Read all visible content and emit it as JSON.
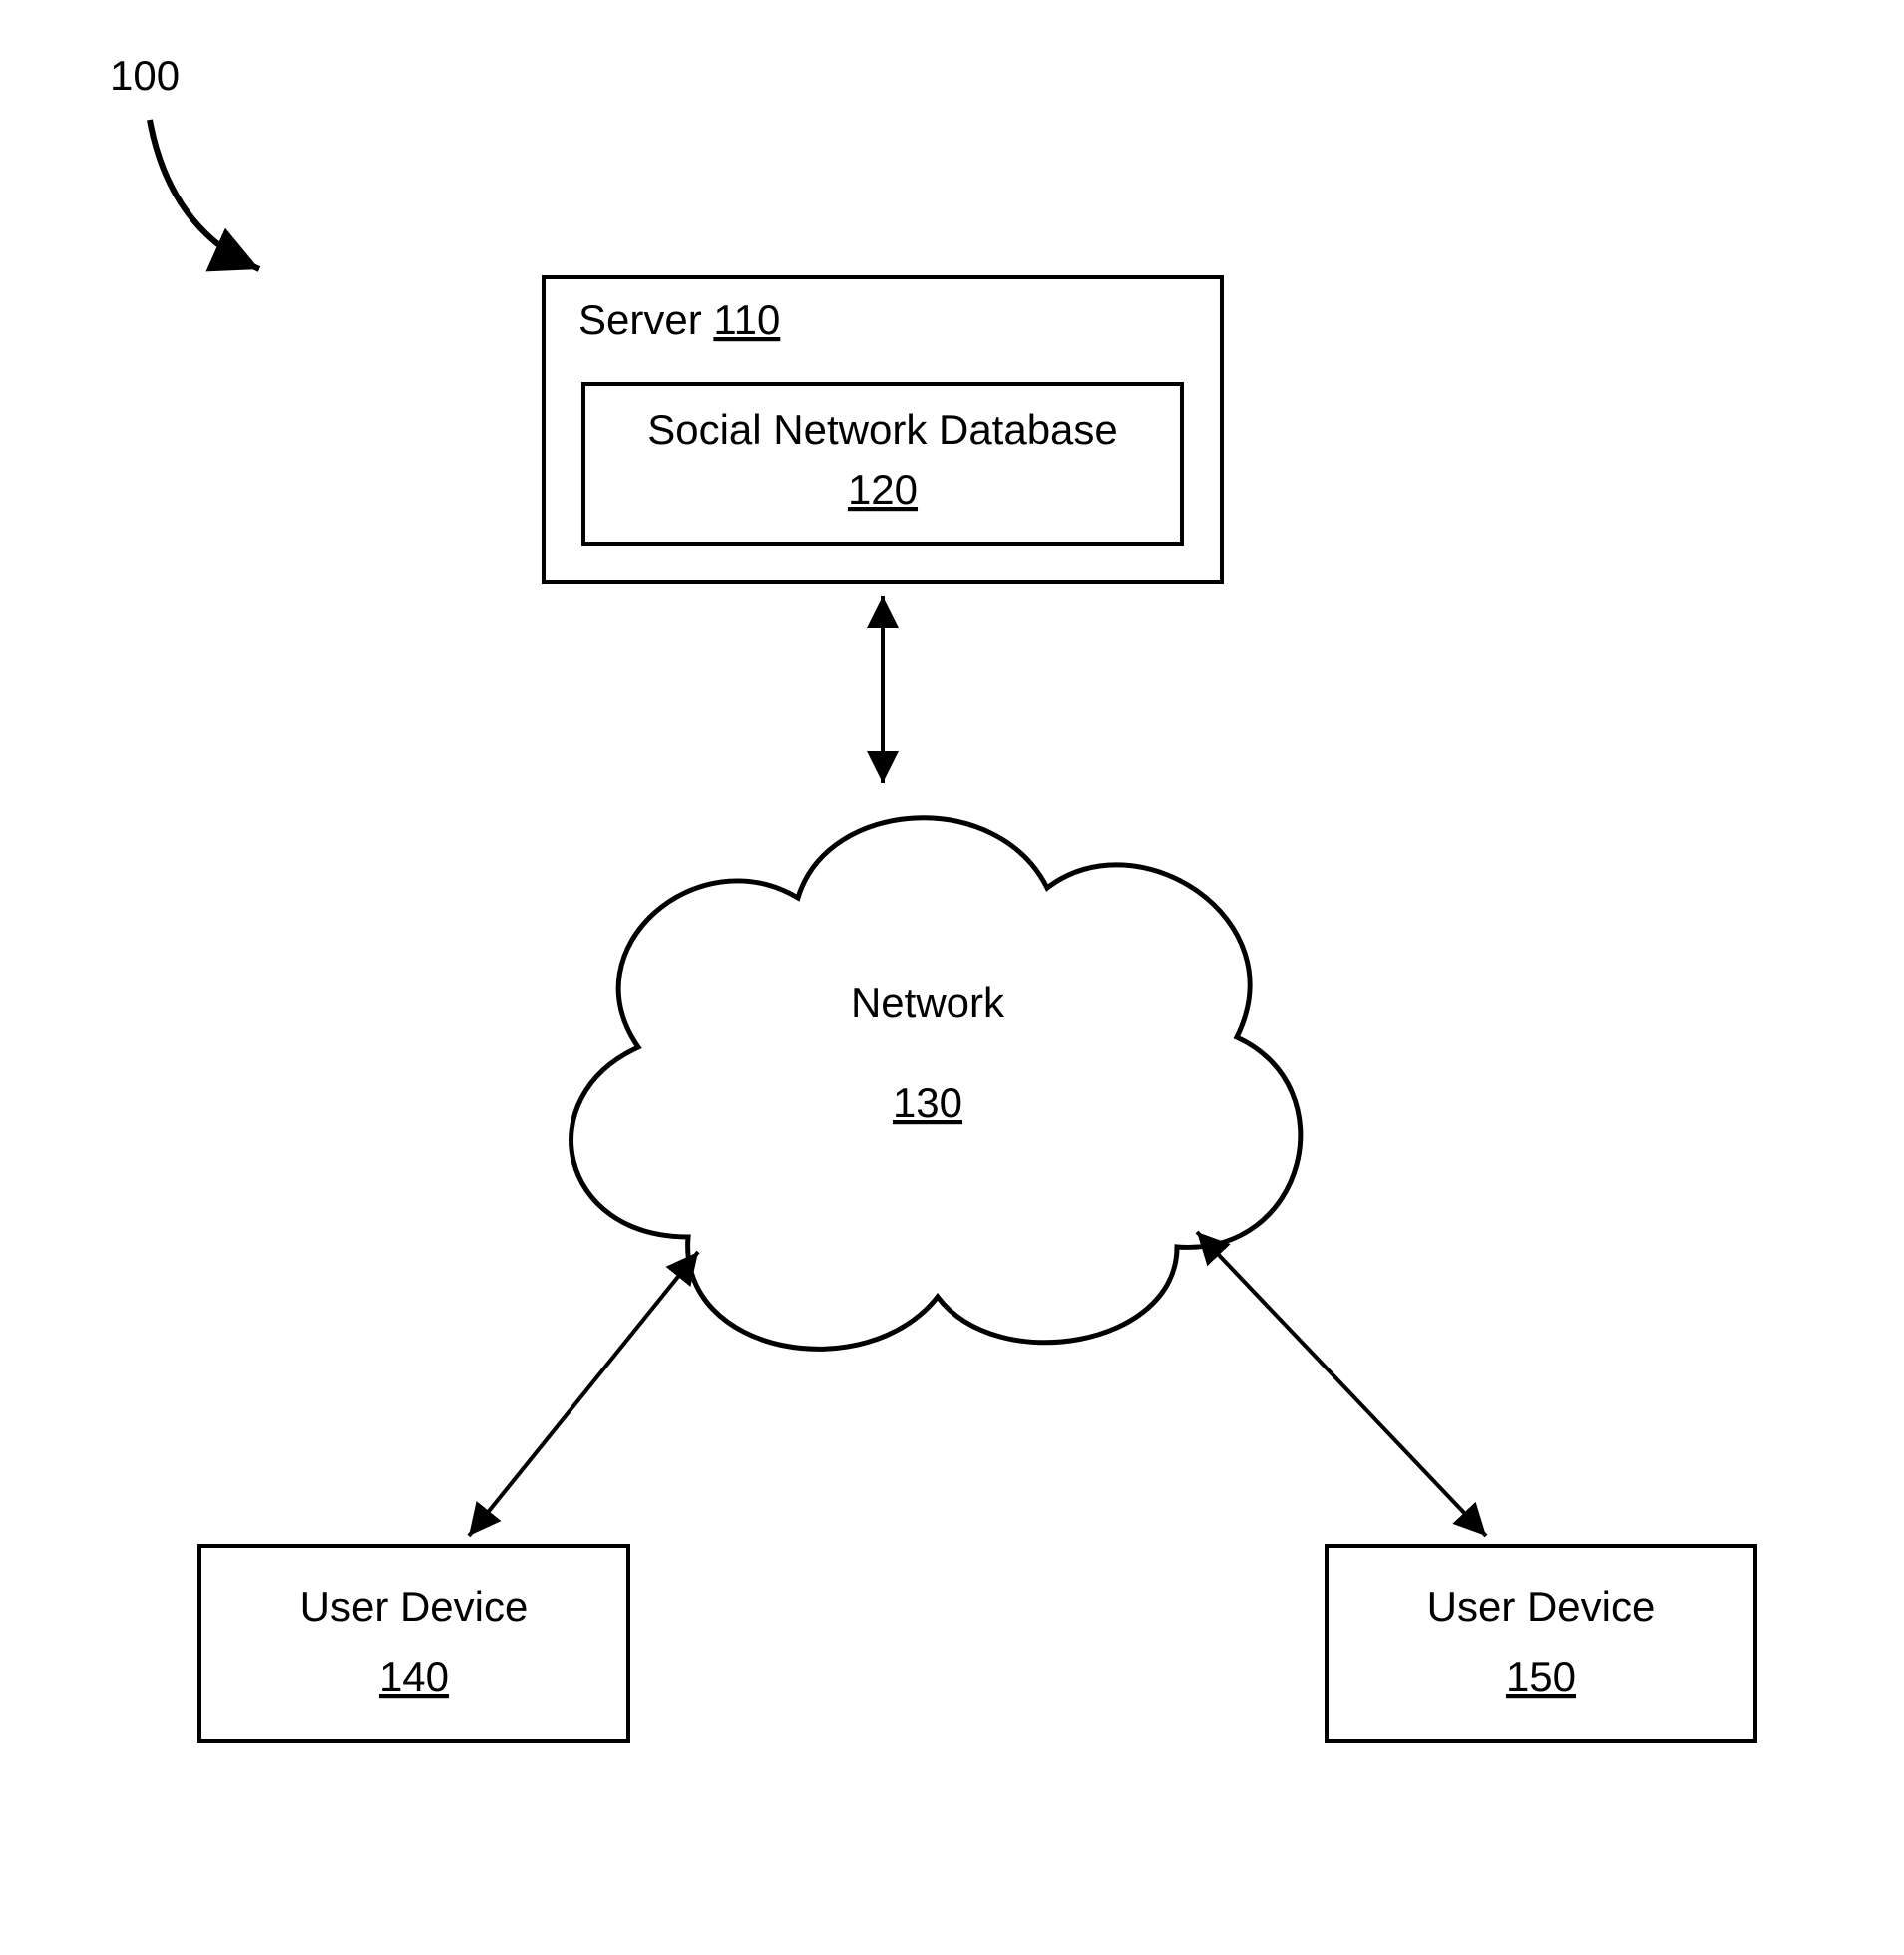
{
  "figure": {
    "ref": "100"
  },
  "server": {
    "label": "Server",
    "ref": "110",
    "database": {
      "label": "Social Network Database",
      "ref": "120"
    }
  },
  "network": {
    "label": "Network",
    "ref": "130"
  },
  "devices": {
    "left": {
      "label": "User Device",
      "ref": "140"
    },
    "right": {
      "label": "User Device",
      "ref": "150"
    }
  }
}
